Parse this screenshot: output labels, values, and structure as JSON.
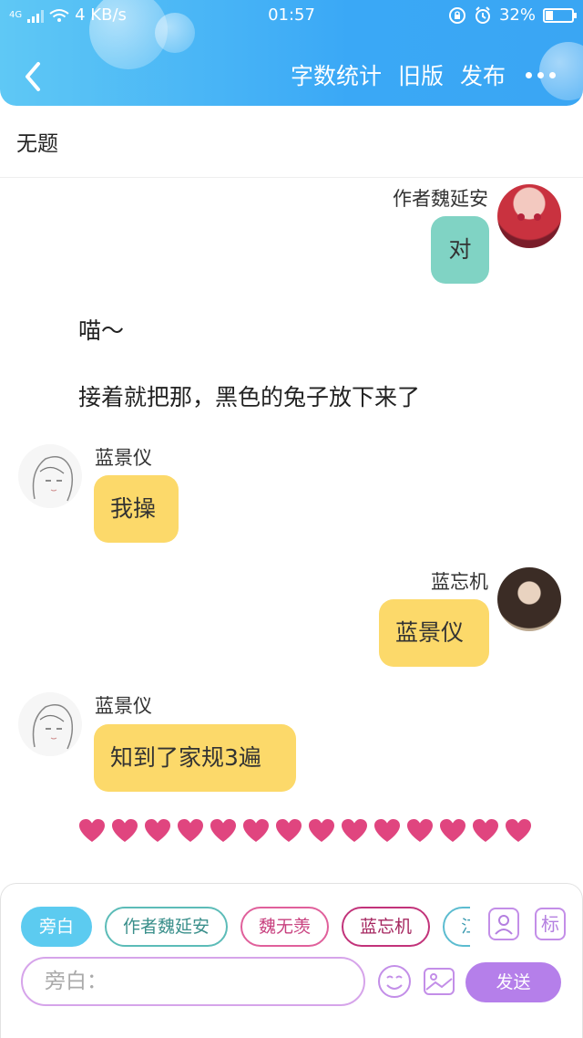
{
  "status_bar": {
    "network": "4G",
    "speed": "4 KB/s",
    "time": "01:57",
    "battery": "32%",
    "battery_level": 0.32
  },
  "nav": {
    "word_count": "字数统计",
    "old_version": "旧版",
    "publish": "发布"
  },
  "title": "无题",
  "messages": [
    {
      "speaker": "作者魏延安",
      "text": "对",
      "side": "right",
      "color": "#80d3c4"
    },
    {
      "narration": "喵～"
    },
    {
      "narration": "接着就把那，黑色的兔子放下来了"
    },
    {
      "speaker": "蓝景仪",
      "text": "我操",
      "side": "left",
      "color": "#fcd96a"
    },
    {
      "speaker": "蓝忘机",
      "text": "蓝景仪",
      "side": "right",
      "color": "#fcd96a"
    },
    {
      "speaker": "蓝景仪",
      "text": "知到了家规3遍",
      "side": "left",
      "color": "#fcd96a"
    }
  ],
  "hearts": {
    "count": 14,
    "color": "#e0457f"
  },
  "character_chips": [
    "旁白",
    "作者魏延安",
    "魏无羡",
    "蓝忘机",
    "江澄"
  ],
  "tag_button": "标",
  "input": {
    "placeholder": "旁白："
  },
  "send_label": "发送",
  "icons": [
    "back-arrow-icon",
    "more-icon",
    "person-icon",
    "emoji-icon",
    "image-icon"
  ]
}
